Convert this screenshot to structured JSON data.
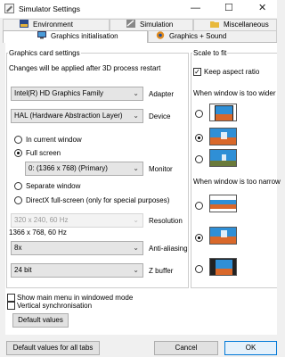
{
  "window": {
    "title": "Simulator Settings",
    "controls": {
      "minimize": "—",
      "maximize": "☐",
      "close": "✕"
    }
  },
  "tabs": {
    "row1": [
      "Environment",
      "Simulation",
      "Miscellaneous"
    ],
    "row2": [
      "Graphics initialisation",
      "Graphics + Sound"
    ],
    "active": "Graphics initialisation"
  },
  "graphics_card": {
    "group_label": "Graphics card settings",
    "note": "Changes will be applied after 3D process restart",
    "adapter": {
      "value": "Intel(R) HD Graphics Family",
      "label": "Adapter"
    },
    "device": {
      "value": "HAL (Hardware Abstraction Layer)",
      "label": "Device"
    },
    "mode_options": [
      "In current window",
      "Full screen"
    ],
    "mode_selected": "Full screen",
    "monitor": {
      "value": "0: (1366 x 768)  (Primary)",
      "label": "Monitor"
    },
    "separate_window": "Separate window",
    "directx_fullscreen": "DirectX full-screen (only for special purposes)",
    "resolution": {
      "value": "320 x 240, 60 Hz",
      "label": "Resolution",
      "current": "1366 x 768, 60 Hz"
    },
    "anti_aliasing": {
      "value": "8x",
      "label": "Anti-aliasing"
    },
    "zbuffer": {
      "value": "24 bit",
      "label": "Z buffer"
    }
  },
  "options": {
    "show_main_menu": "Show main menu in windowed mode",
    "vertical_sync": "Vertical synchronisation",
    "default_values": "Default values"
  },
  "scale": {
    "group_label": "Scale to fit",
    "keep_aspect": {
      "label": "Keep aspect ratio",
      "checked": true
    },
    "wider_label": "When window is too wider",
    "wider_selected": 1,
    "narrower_label": "When window is too narrow",
    "narrower_selected": 1
  },
  "footer": {
    "all_tabs": "Default values for all tabs",
    "cancel": "Cancel",
    "ok": "OK"
  },
  "colors": {
    "accent": "#0078d7",
    "thumb_sky": "#2f8fd6",
    "thumb_dark": "#222222",
    "thumb_orange": "#d9682a"
  },
  "icons": {
    "app": "settings-app-icon",
    "environment": "environment-tab-icon",
    "simulation": "simulation-tab-icon",
    "misc": "folder-icon",
    "graphics_init": "monitor-icon",
    "graphics_sound": "speaker-icon"
  }
}
